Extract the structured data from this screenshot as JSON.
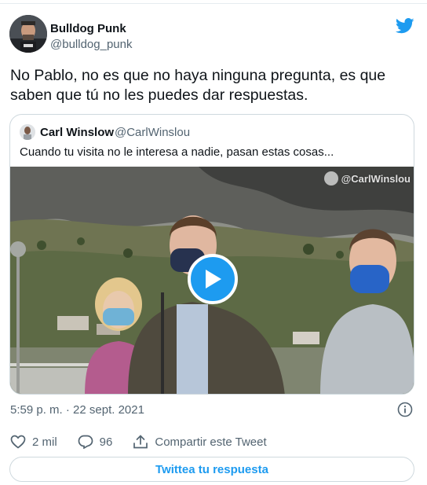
{
  "tweet": {
    "author_name": "Bulldog Punk",
    "author_handle": "@bulldog_punk",
    "text": "No Pablo, no es que no haya ninguna pregunta, es que saben que tú no les puedes dar respuestas.",
    "timestamp": "5:59 p. m. · 22 sept. 2021"
  },
  "quoted": {
    "author_name": "Carl Winslow",
    "author_handle": "@CarlWinslou",
    "text": "Cuando tu visita no le interesa a nadie, pasan estas cosas...",
    "watermark": "@CarlWinslou"
  },
  "actions": {
    "likes": "2 mil",
    "replies": "96",
    "share_label": "Compartir este Tweet"
  },
  "reply_button_label": "Twittea tu respuesta",
  "colors": {
    "accent": "#1d9bf0",
    "text": "#0f1419",
    "secondary": "#536471",
    "border": "#cfd9de"
  },
  "icons": [
    "twitter-bird-icon",
    "play-icon",
    "info-icon",
    "heart-icon",
    "reply-icon",
    "share-icon"
  ]
}
